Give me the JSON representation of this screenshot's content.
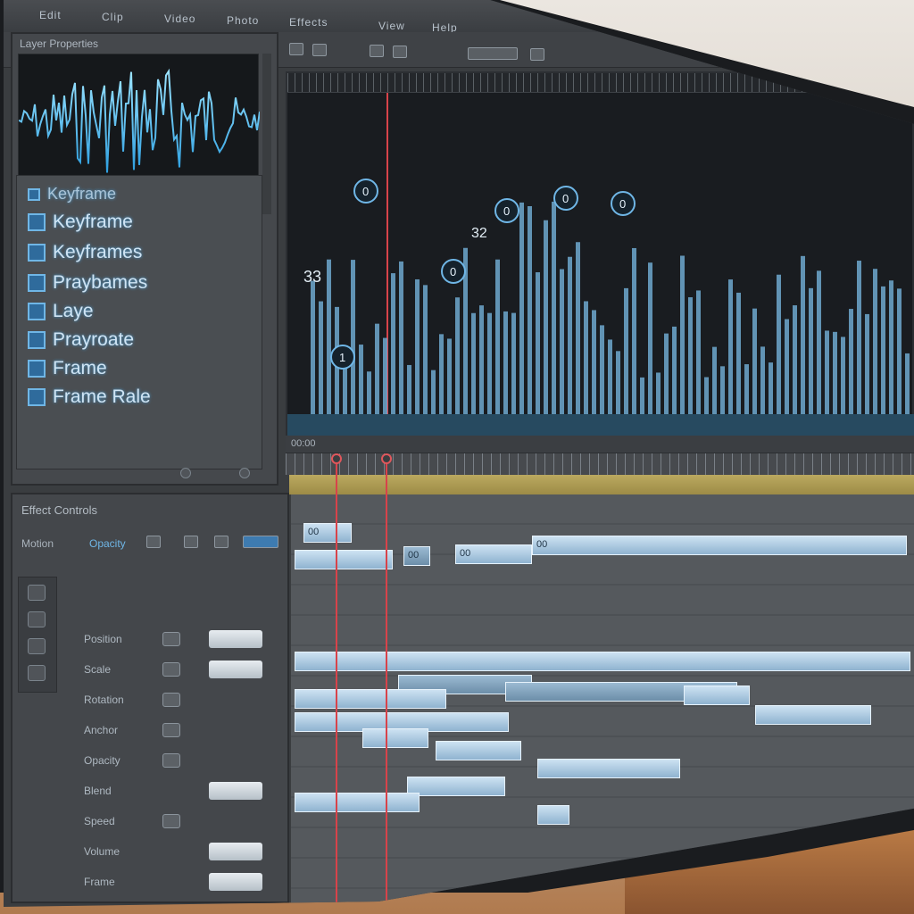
{
  "menubar": {
    "items": [
      "Edit",
      "Clip",
      "Video",
      "Photo",
      "Effects"
    ],
    "right_items": [
      "View",
      "Help"
    ]
  },
  "left_panel": {
    "title": "Layer Properties",
    "items": [
      {
        "label": "Keyframe",
        "small": true
      },
      {
        "label": "Keyframe"
      },
      {
        "label": "Keyframes"
      },
      {
        "label": "Praybames"
      },
      {
        "label": "Laye"
      },
      {
        "label": "Prayroate"
      },
      {
        "label": "Frame"
      },
      {
        "label": "Frame Rale"
      }
    ]
  },
  "graph": {
    "annotations": [
      "33",
      "32"
    ],
    "markers": [
      "0",
      "1",
      "0",
      "0",
      "0",
      "0"
    ]
  },
  "timeline": {
    "ruler_label": "00:00",
    "clips": [
      {
        "label": "00"
      },
      {
        "label": "00"
      },
      {
        "label": "00"
      },
      {
        "label": "00"
      }
    ]
  },
  "bottom_panel": {
    "title": "Effect Controls",
    "tabs": [
      "Motion",
      "Opacity"
    ],
    "rows": [
      "Position",
      "Scale",
      "Rotation",
      "Anchor",
      "Opacity",
      "Blend",
      "Speed",
      "Volume",
      "Frame"
    ]
  },
  "colors": {
    "accent": "#6fb6e6",
    "playhead": "#d8434a",
    "graph_bar": "#6fa8cf",
    "clip": "#a9c8e0"
  }
}
